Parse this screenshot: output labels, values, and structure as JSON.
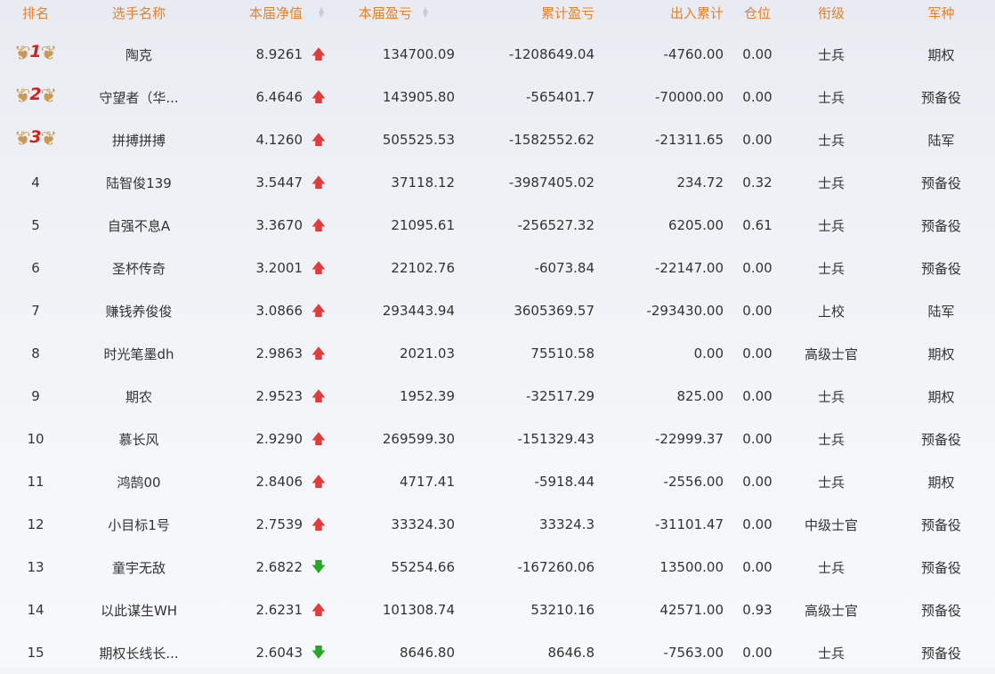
{
  "header": {
    "rank": "排名",
    "name": "选手名称",
    "nav": "本届净值",
    "profit": "本届盈亏",
    "cum": "累计盈亏",
    "flow": "出入累计",
    "position": "仓位",
    "rank_title": "衔级",
    "army": "军种"
  },
  "rows": [
    {
      "rank": "1",
      "name": "陶克",
      "nav": "8.9261",
      "trend": "up",
      "profit": "134700.09",
      "cum": "-1208649.04",
      "flow": "-4760.00",
      "position": "0.00",
      "title": "士兵",
      "army": "期权"
    },
    {
      "rank": "2",
      "name": "守望者（华...",
      "nav": "6.4646",
      "trend": "up",
      "profit": "143905.80",
      "cum": "-565401.7",
      "flow": "-70000.00",
      "position": "0.00",
      "title": "士兵",
      "army": "预备役"
    },
    {
      "rank": "3",
      "name": "拼搏拼搏",
      "nav": "4.1260",
      "trend": "up",
      "profit": "505525.53",
      "cum": "-1582552.62",
      "flow": "-21311.65",
      "position": "0.00",
      "title": "士兵",
      "army": "陆军"
    },
    {
      "rank": "4",
      "name": "陆智俊139",
      "nav": "3.5447",
      "trend": "up",
      "profit": "37118.12",
      "cum": "-3987405.02",
      "flow": "234.72",
      "position": "0.32",
      "title": "士兵",
      "army": "预备役"
    },
    {
      "rank": "5",
      "name": "自强不息A",
      "nav": "3.3670",
      "trend": "up",
      "profit": "21095.61",
      "cum": "-256527.32",
      "flow": "6205.00",
      "position": "0.61",
      "title": "士兵",
      "army": "预备役"
    },
    {
      "rank": "6",
      "name": "圣杯传奇",
      "nav": "3.2001",
      "trend": "up",
      "profit": "22102.76",
      "cum": "-6073.84",
      "flow": "-22147.00",
      "position": "0.00",
      "title": "士兵",
      "army": "预备役"
    },
    {
      "rank": "7",
      "name": "赚钱养俊俊",
      "nav": "3.0866",
      "trend": "up",
      "profit": "293443.94",
      "cum": "3605369.57",
      "flow": "-293430.00",
      "position": "0.00",
      "title": "上校",
      "army": "陆军"
    },
    {
      "rank": "8",
      "name": "时光笔墨dh",
      "nav": "2.9863",
      "trend": "up",
      "profit": "2021.03",
      "cum": "75510.58",
      "flow": "0.00",
      "position": "0.00",
      "title": "高级士官",
      "army": "期权"
    },
    {
      "rank": "9",
      "name": "期农",
      "nav": "2.9523",
      "trend": "up",
      "profit": "1952.39",
      "cum": "-32517.29",
      "flow": "825.00",
      "position": "0.00",
      "title": "士兵",
      "army": "期权"
    },
    {
      "rank": "10",
      "name": "慕长风",
      "nav": "2.9290",
      "trend": "up",
      "profit": "269599.30",
      "cum": "-151329.43",
      "flow": "-22999.37",
      "position": "0.00",
      "title": "士兵",
      "army": "预备役"
    },
    {
      "rank": "11",
      "name": "鸿鹄00",
      "nav": "2.8406",
      "trend": "up",
      "profit": "4717.41",
      "cum": "-5918.44",
      "flow": "-2556.00",
      "position": "0.00",
      "title": "士兵",
      "army": "期权"
    },
    {
      "rank": "12",
      "name": "小目标1号",
      "nav": "2.7539",
      "trend": "up",
      "profit": "33324.30",
      "cum": "33324.3",
      "flow": "-31101.47",
      "position": "0.00",
      "title": "中级士官",
      "army": "预备役"
    },
    {
      "rank": "13",
      "name": "童宇无敌",
      "nav": "2.6822",
      "trend": "down",
      "profit": "55254.66",
      "cum": "-167260.06",
      "flow": "13500.00",
      "position": "0.00",
      "title": "士兵",
      "army": "预备役"
    },
    {
      "rank": "14",
      "name": "以此谋生WH",
      "nav": "2.6231",
      "trend": "up",
      "profit": "101308.74",
      "cum": "53210.16",
      "flow": "42571.00",
      "position": "0.93",
      "title": "高级士官",
      "army": "预备役"
    },
    {
      "rank": "15",
      "name": "期权长线长...",
      "nav": "2.6043",
      "trend": "down",
      "profit": "8646.80",
      "cum": "8646.8",
      "flow": "-7563.00",
      "position": "0.00",
      "title": "士兵",
      "army": "预备役"
    }
  ],
  "colors": {
    "header_text": "#e6802b",
    "up_arrow": "#e23b3b",
    "down_arrow": "#2aa62a",
    "medal_wing": "#c99a56",
    "medal_number": "#d62020"
  },
  "icons": {
    "up": "arrow-up-icon",
    "down": "arrow-down-icon",
    "medal": "wing-medal-icon",
    "sort": "sort-icon"
  }
}
